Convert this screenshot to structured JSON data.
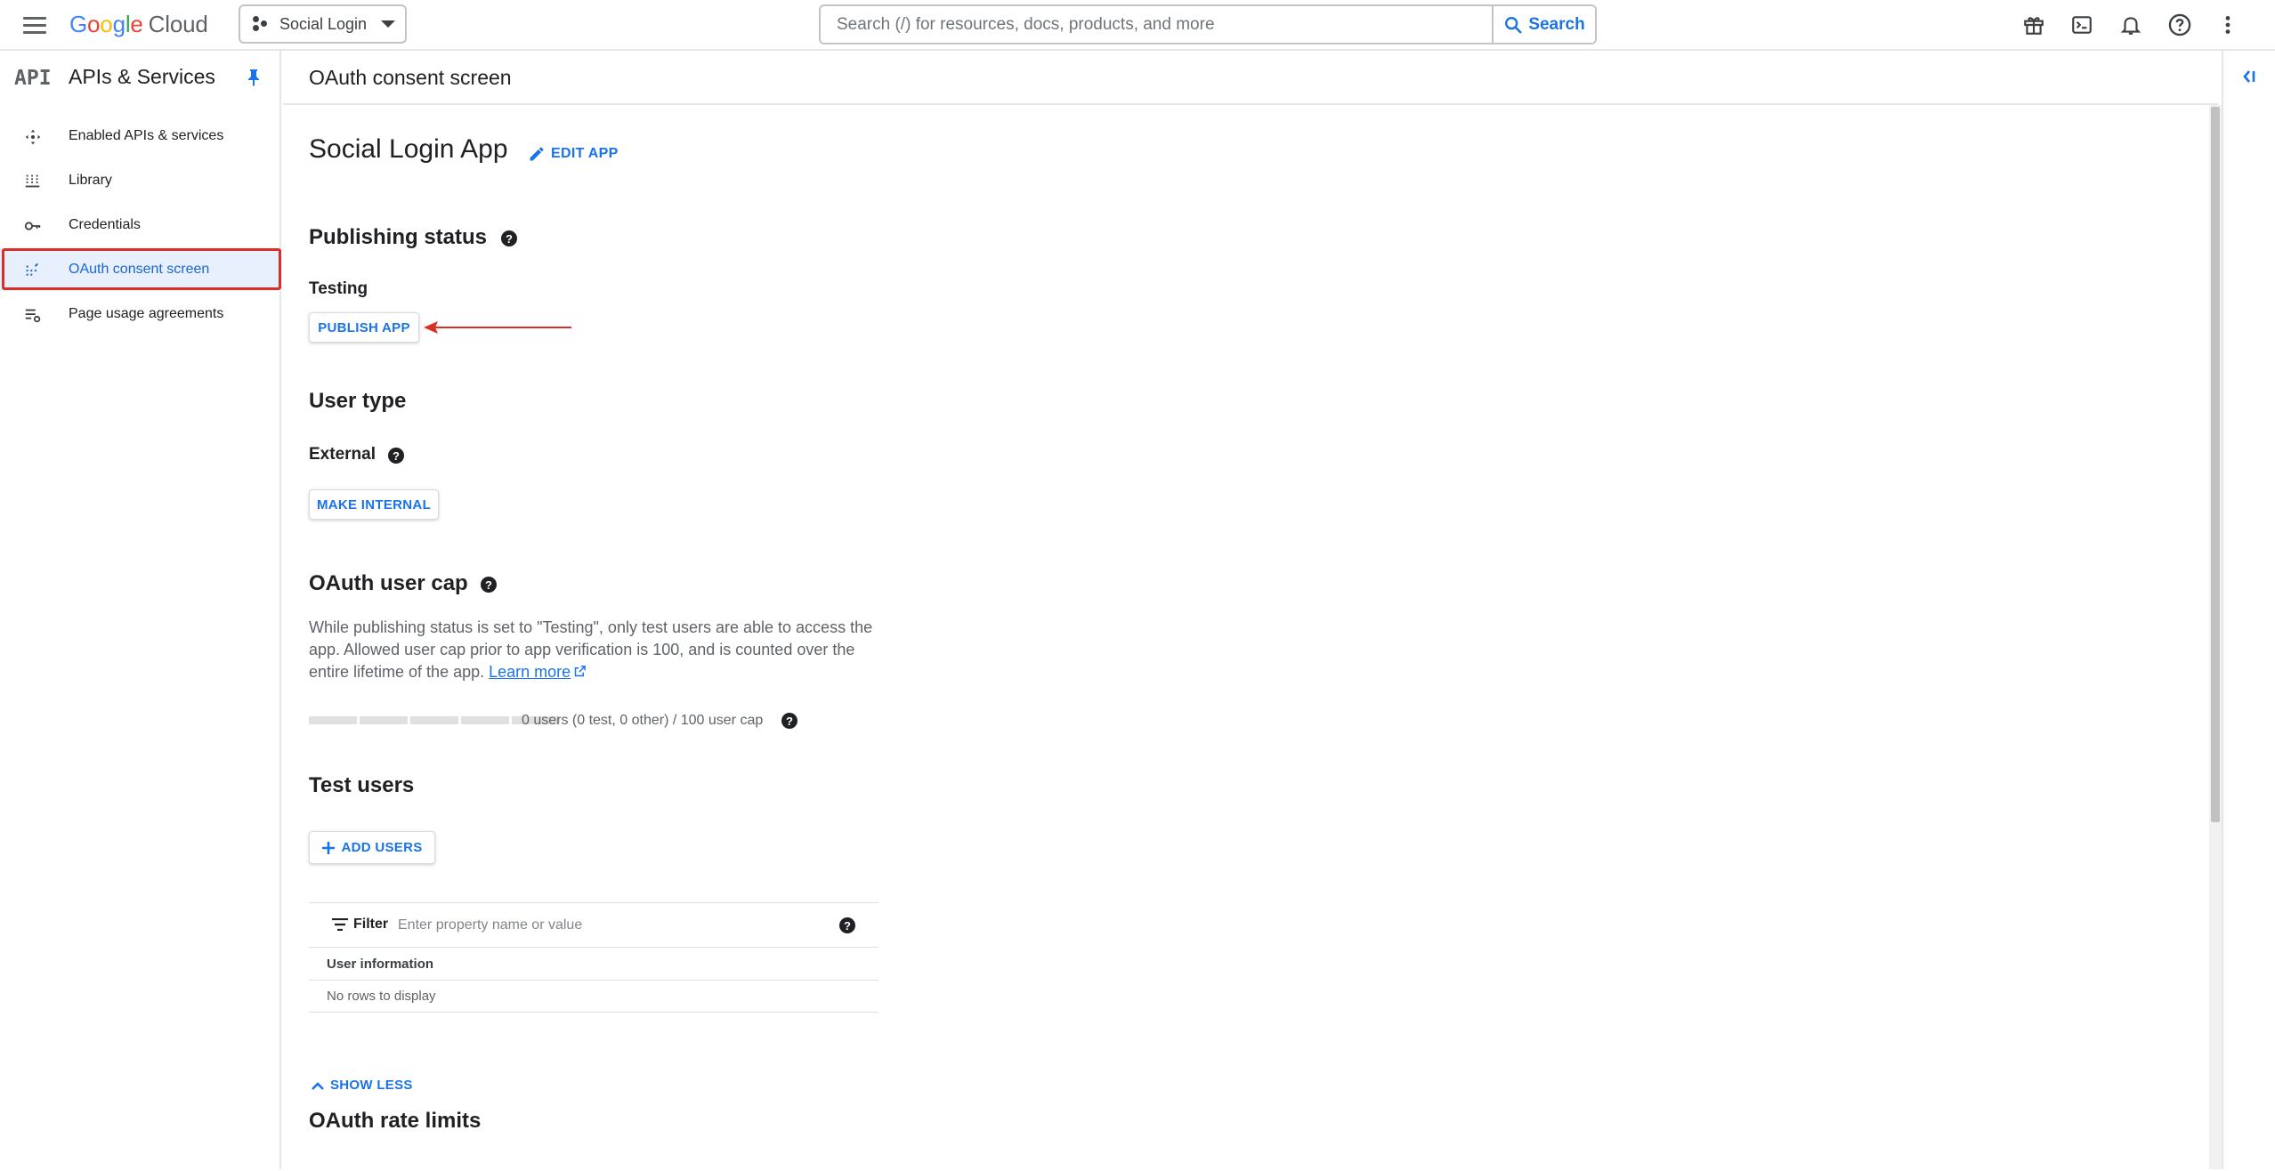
{
  "topbar": {
    "logo_letters": [
      "G",
      "o",
      "o",
      "g",
      "l",
      "e"
    ],
    "logo_suffix": "Cloud",
    "project_name": "Social Login",
    "search_placeholder": "Search (/) for resources, docs, products, and more",
    "search_button": "Search",
    "icons": [
      "gift-icon",
      "terminal-icon",
      "bell-icon",
      "help-icon",
      "more-vert-icon"
    ]
  },
  "sidebar": {
    "badge": "API",
    "title": "APIs & Services",
    "items": [
      {
        "label": "Enabled APIs & services",
        "icon": "enabled-apis-icon"
      },
      {
        "label": "Library",
        "icon": "library-icon"
      },
      {
        "label": "Credentials",
        "icon": "key-icon"
      },
      {
        "label": "OAuth consent screen",
        "icon": "consent-icon",
        "active": true
      },
      {
        "label": "Page usage agreements",
        "icon": "agreements-icon"
      }
    ]
  },
  "main": {
    "page_title": "OAuth consent screen",
    "app_name": "Social Login App",
    "edit_app": "EDIT APP",
    "publishing": {
      "title": "Publishing status",
      "status": "Testing",
      "publish_button": "PUBLISH APP"
    },
    "user_type": {
      "title": "User type",
      "value": "External",
      "make_internal_button": "MAKE INTERNAL"
    },
    "user_cap": {
      "title": "OAuth user cap",
      "description": "While publishing status is set to \"Testing\", only test users are able to access the app. Allowed user cap prior to app verification is 100, and is counted over the entire lifetime of the app.",
      "learn_more": "Learn more",
      "usage": "0 users (0 test, 0 other) / 100 user cap",
      "usage_fraction": 0
    },
    "test_users": {
      "title": "Test users",
      "add_users_button": "ADD USERS",
      "filter_label": "Filter",
      "filter_placeholder": "Enter property name or value",
      "column_header": "User information",
      "empty_text": "No rows to display"
    },
    "show_less": "SHOW LESS",
    "rate_limits_title": "OAuth rate limits"
  },
  "colors": {
    "accent": "#1a73e8",
    "annotation_red": "#d93025",
    "active_bg": "#e8f0fe"
  }
}
